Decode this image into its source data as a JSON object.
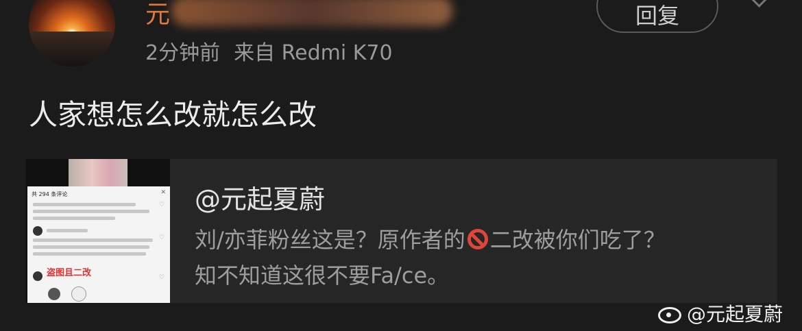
{
  "comment": {
    "author_name": "元",
    "time": "2分钟前",
    "source": "来自 Redmi K70",
    "reply_label": "回复",
    "text": "人家想怎么改就怎么改"
  },
  "quote": {
    "author": "@元起夏蔚",
    "line1_before": "刘/亦菲粉丝这是？原作者的",
    "line1_after": "二改被你们吃了？",
    "line2": "知不知道这很不要Fa/ce。",
    "thumbnail": {
      "comments_header": "共 294 条评论",
      "overlay_text": "盗图且二改"
    }
  },
  "watermark": "@元起夏蔚",
  "colors": {
    "background": "#1b1b1b",
    "card": "#262626",
    "name": "#e07a3a",
    "meta": "#9a9a9a"
  }
}
